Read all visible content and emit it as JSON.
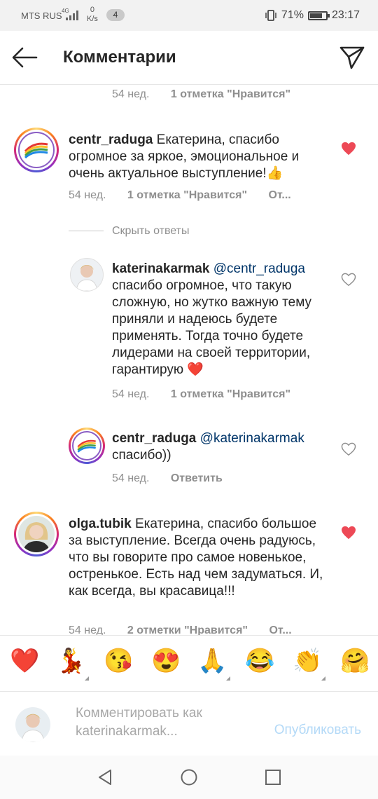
{
  "status_bar": {
    "carrier": "MTS RUS",
    "network": "4G",
    "speed_value": "0",
    "speed_unit": "K/s",
    "notification_count": "4",
    "battery_percent": "71%",
    "battery_level": 0.71,
    "time": "23:17"
  },
  "header": {
    "title": "Комментарии"
  },
  "comments": [
    {
      "meta_time": "54 нед.",
      "meta_likes": "1 отметка \"Нравится\""
    },
    {
      "username": "centr_raduga",
      "text": " Екатерина, спасибо огромное за яркое, эмоциональное и очень актуальное выступление!👍",
      "meta_time": "54 нед.",
      "meta_likes": "1 отметка \"Нравится\"",
      "meta_reply": "От...",
      "liked": true,
      "hide_replies": "Скрыть ответы"
    },
    {
      "username": "katerinakarmak",
      "mention": " @centr_raduga",
      "text": " спасибо огромное, что такую сложную, но жутко важную тему приняли и надеюсь будете применять. Тогда точно будете лидерами на своей территории, гарантирую ❤️",
      "meta_time": "54 нед.",
      "meta_likes": "1 отметка \"Нравится\"",
      "liked": false
    },
    {
      "username": "centr_raduga",
      "mention": " @katerinakarmak",
      "text": " спасибо))",
      "meta_time": "54 нед.",
      "meta_reply": "Ответить",
      "liked": false
    },
    {
      "username": "olga.tubik",
      "text": " Екатерина, спасибо большое за выступление. Всегда очень радуюсь, что вы говорите про самое новенькое, остренькое. Есть над чем задуматься. И, как всегда, вы красавица!!!",
      "meta_time": "54 нед.",
      "meta_likes": "2 отметки \"Нравится\"",
      "meta_reply": "От...",
      "liked": true
    }
  ],
  "emoji_bar": [
    "❤️",
    "💃",
    "😘",
    "😍",
    "🙏",
    "😂",
    "👏",
    "🤗"
  ],
  "input": {
    "placeholder": "Комментировать как katerinakarmak...",
    "publish_label": "Опубликовать"
  },
  "colors": {
    "accent_blue": "#b3d9f7",
    "heart_red": "#ed4956",
    "mention_blue": "#003569",
    "meta_gray": "#8e8e8e"
  }
}
